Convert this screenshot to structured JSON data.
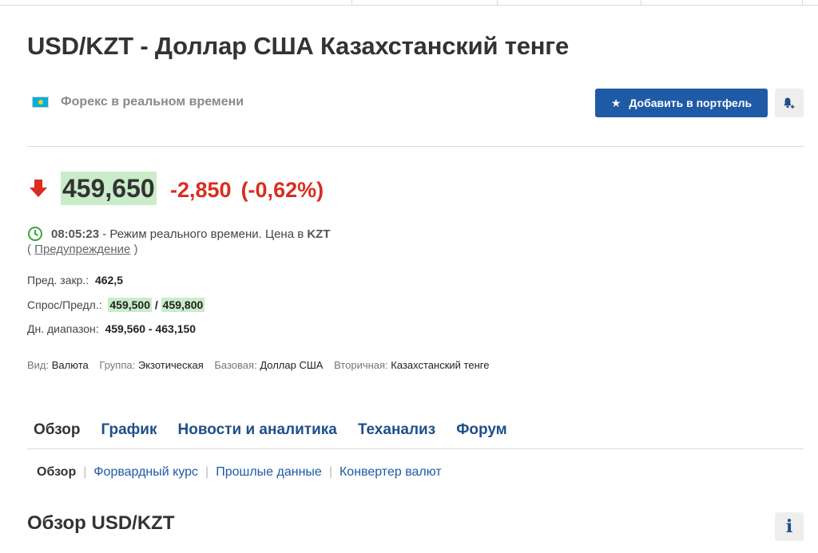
{
  "header": {
    "title": "USD/KZT - Доллар США Казахстанский тенге",
    "subtitle": "Форекс в реальном времени",
    "add_button": "Добавить в портфель"
  },
  "quote": {
    "price": "459,650",
    "change": "-2,850",
    "change_pct": "(-0,62%)",
    "direction": "down",
    "time": "08:05:23",
    "mode_text": "- Режим реального времени.  Цена в",
    "currency": "KZT",
    "warning_link": "Предупреждение",
    "colors": {
      "down": "#d92d20",
      "highlight": "#c9ecc9",
      "accent": "#1f5aa6"
    }
  },
  "stats": {
    "prev_close_label": "Пред. закр.:",
    "prev_close": "462,5",
    "bid_ask_label": "Спрос/Предл.:",
    "bid": "459,500",
    "ask": "459,800",
    "day_range_label": "Дн. диапазон:",
    "day_range": "459,560 - 463,150"
  },
  "meta": {
    "type_label": "Вид:",
    "type": "Валюта",
    "group_label": "Группа:",
    "group": "Экзотическая",
    "base_label": "Базовая:",
    "base": "Доллар США",
    "secondary_label": "Вторичная:",
    "secondary": "Казахстанский тенге"
  },
  "tabs": [
    {
      "label": "Обзор",
      "active": true
    },
    {
      "label": "График"
    },
    {
      "label": "Новости и аналитика"
    },
    {
      "label": "Теханализ"
    },
    {
      "label": "Форум"
    }
  ],
  "subtabs": [
    {
      "label": "Обзор",
      "active": true
    },
    {
      "label": "Форвардный курс"
    },
    {
      "label": "Прошлые данные"
    },
    {
      "label": "Конвертер валют"
    }
  ],
  "section": {
    "title": "Обзор USD/KZT"
  }
}
